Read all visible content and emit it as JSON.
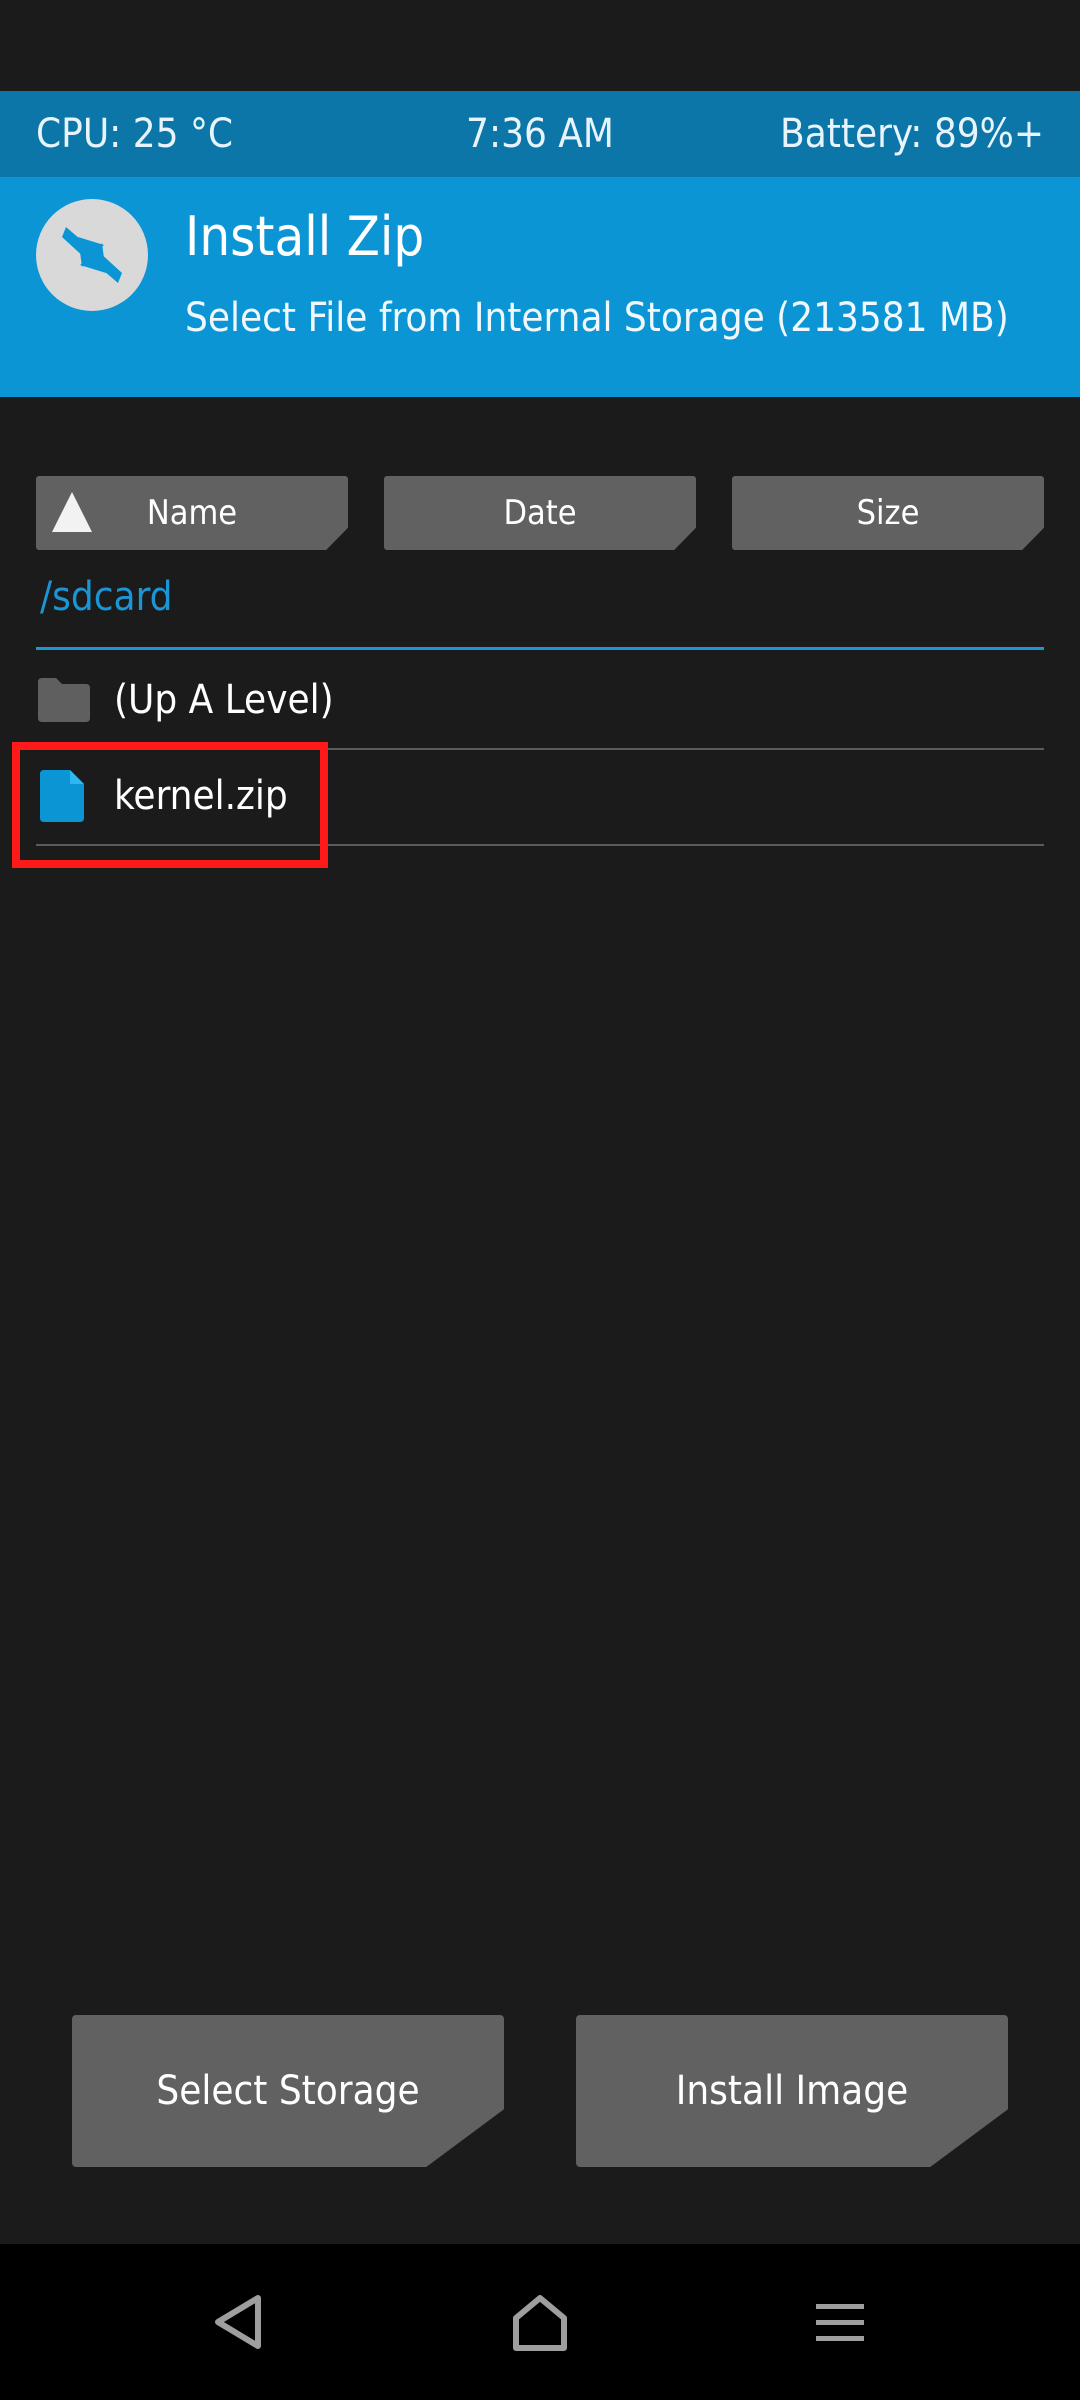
{
  "status": {
    "cpu": "CPU: 25 °C",
    "time": "7:36 AM",
    "battery": "Battery: 89%+"
  },
  "header": {
    "title": "Install Zip",
    "subtitle": "Select File from Internal Storage (213581 MB)",
    "logo_icon": "twrp-logo-icon"
  },
  "sort": {
    "name_label": "Name",
    "date_label": "Date",
    "size_label": "Size",
    "active_sort": "Name"
  },
  "browser": {
    "path": "/sdcard",
    "items": [
      {
        "label": "(Up A Level)",
        "icon": "folder-icon"
      },
      {
        "label": "kernel.zip",
        "icon": "file-icon"
      }
    ]
  },
  "actions": {
    "select_storage": "Select Storage",
    "install_image": "Install Image"
  },
  "colors": {
    "accent": "#0b95d4",
    "status_bar": "#0d76a8",
    "background": "#1b1b1b",
    "button": "#616161",
    "highlight": "#ff1a1a"
  }
}
